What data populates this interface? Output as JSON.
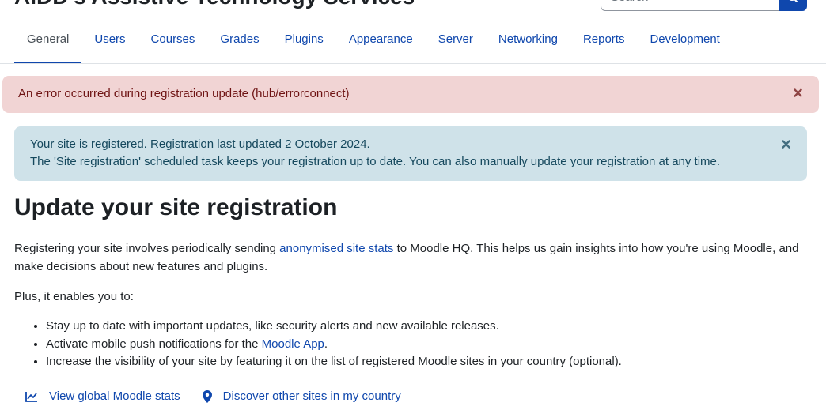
{
  "header": {
    "site_title": "AIDD's Assistive Technology Services",
    "search_placeholder": "Search"
  },
  "nav": {
    "tabs": [
      {
        "label": "General",
        "active": true
      },
      {
        "label": "Users",
        "active": false
      },
      {
        "label": "Courses",
        "active": false
      },
      {
        "label": "Grades",
        "active": false
      },
      {
        "label": "Plugins",
        "active": false
      },
      {
        "label": "Appearance",
        "active": false
      },
      {
        "label": "Server",
        "active": false
      },
      {
        "label": "Networking",
        "active": false
      },
      {
        "label": "Reports",
        "active": false
      },
      {
        "label": "Development",
        "active": false
      }
    ]
  },
  "alerts": {
    "error": {
      "text": "An error occurred during registration update (hub/errorconnect)",
      "close": "×"
    },
    "info": {
      "line1": "Your site is registered. Registration last updated 2 October 2024.",
      "line2": "The 'Site registration' scheduled task keeps your registration up to date. You can also manually update your registration at any time.",
      "close": "×"
    }
  },
  "main": {
    "heading": "Update your site registration",
    "intro_before": "Registering your site involves periodically sending ",
    "intro_link": "anonymised site stats",
    "intro_after": " to Moodle HQ. This helps us gain insights into how you're using Moodle, and make decisions about new features and plugins.",
    "plus": "Plus, it enables you to:",
    "bullets": {
      "b1": "Stay up to date with important updates, like security alerts and new available releases.",
      "b2_before": "Activate mobile push notifications for the ",
      "b2_link": "Moodle App",
      "b2_after": ".",
      "b3": "Increase the visibility of your site by featuring it on the list of registered Moodle sites in your country (optional)."
    },
    "links": {
      "stats": "View global Moodle stats",
      "discover": "Discover other sites in my country"
    }
  },
  "colors": {
    "brand": "#0f47ad",
    "error_bg": "#f1d4d4",
    "info_bg": "#cfe2e9"
  }
}
